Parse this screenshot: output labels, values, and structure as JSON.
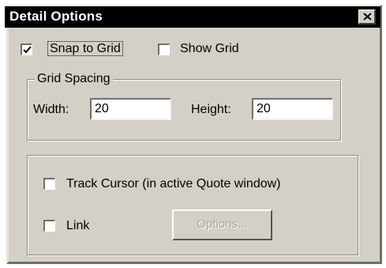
{
  "window": {
    "title": "Detail Options",
    "close_icon": "close-icon"
  },
  "options": {
    "snap_to_grid": {
      "label": "Snap to Grid",
      "checked": true
    },
    "show_grid": {
      "label": "Show Grid",
      "checked": false
    }
  },
  "grid_spacing": {
    "legend": "Grid Spacing",
    "width_label": "Width:",
    "width_value": "20",
    "height_label": "Height:",
    "height_value": "20"
  },
  "tracking": {
    "track_cursor": {
      "label": "Track Cursor (in active Quote window)",
      "checked": false
    },
    "link": {
      "label": "Link",
      "checked": false
    },
    "options_button": {
      "label": "Options...",
      "enabled": false
    }
  }
}
